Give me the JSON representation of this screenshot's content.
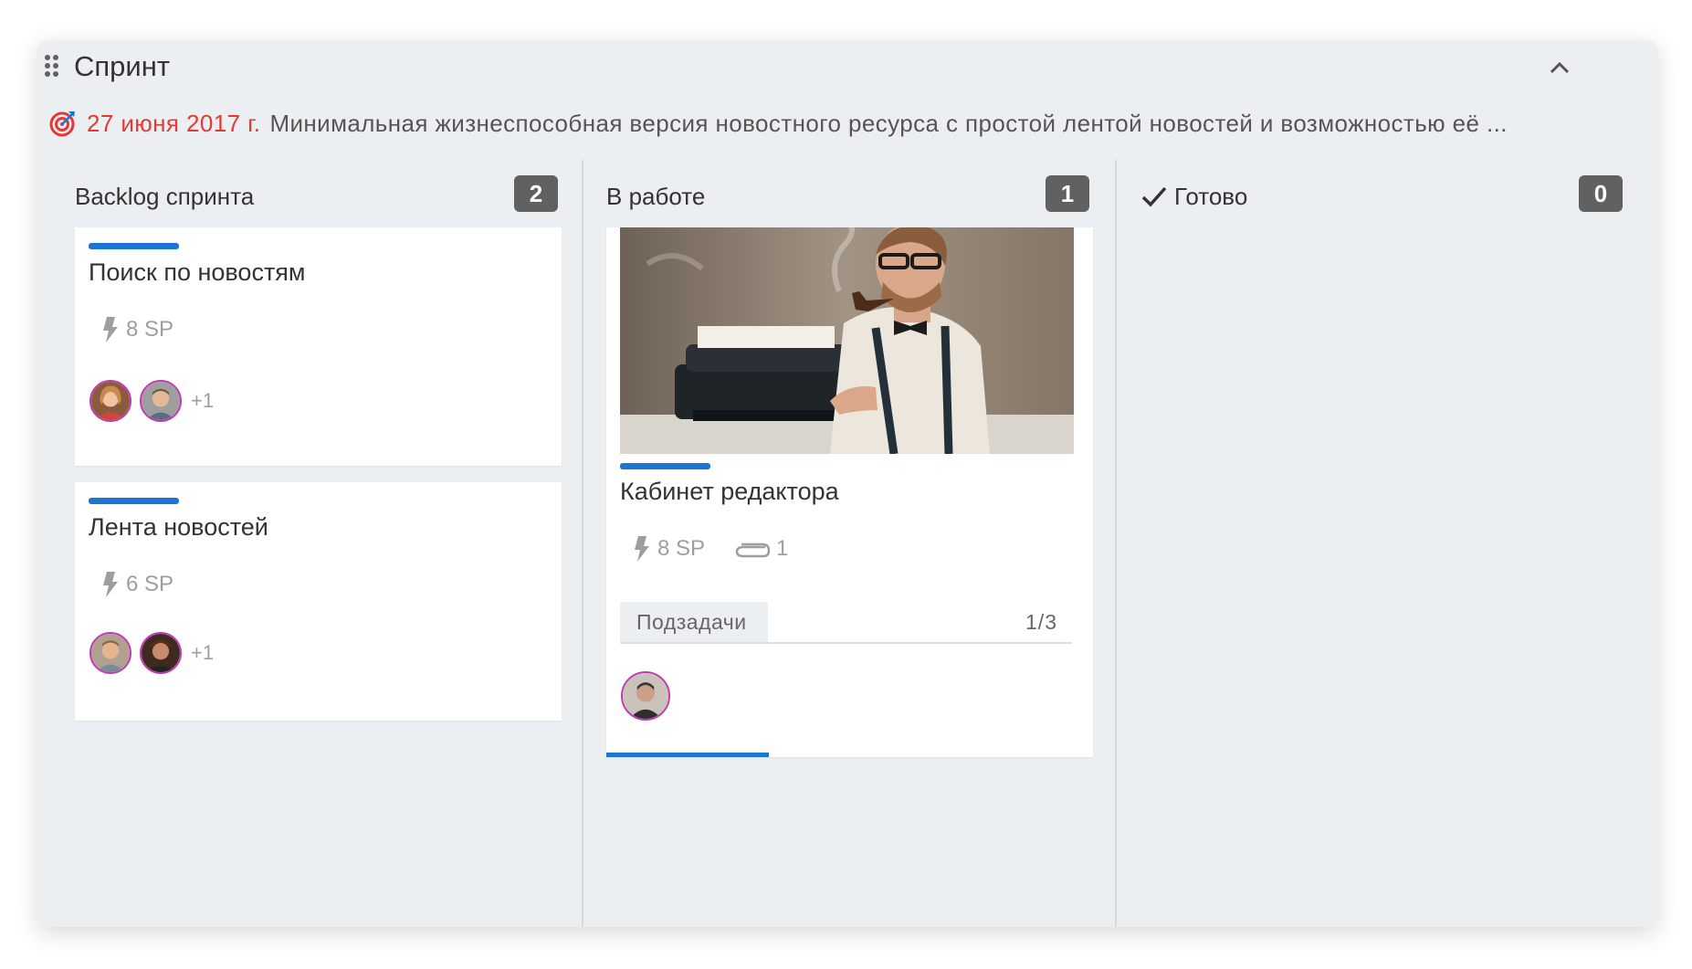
{
  "sprint": {
    "title": "Спринт",
    "goal_date": "27 июня 2017 г.",
    "goal_text": "Минимальная жизнеспособная версия новостного ресурса с простой лентой новостей и возможностью её ..."
  },
  "columns": [
    {
      "title": "Backlog спринта",
      "count": "2",
      "cards": [
        {
          "title": "Поиск по новостям",
          "points": "8 SP",
          "extra": "+1"
        },
        {
          "title": "Лента новостей",
          "points": "6 SP",
          "extra": "+1"
        }
      ]
    },
    {
      "title": "В работе",
      "count": "1",
      "cards": [
        {
          "title": "Кабинет редактора",
          "points": "8 SP",
          "attachments": "1",
          "subtasks_label": "Подзадачи",
          "subtasks_count": "1/3",
          "subtasks_progress": 0.33
        }
      ]
    },
    {
      "title": "Готово",
      "count": "0",
      "cards": []
    }
  ],
  "colors": {
    "accent": "#1976d2",
    "goal_date": "#e53935",
    "badge": "#616161",
    "avatar_ring": "#c23ab0",
    "panel_bg": "#eceff1"
  },
  "icons": [
    "drag-handle-icon",
    "chevron-up-icon",
    "target-icon",
    "lightning-icon",
    "paperclip-icon",
    "check-icon"
  ]
}
